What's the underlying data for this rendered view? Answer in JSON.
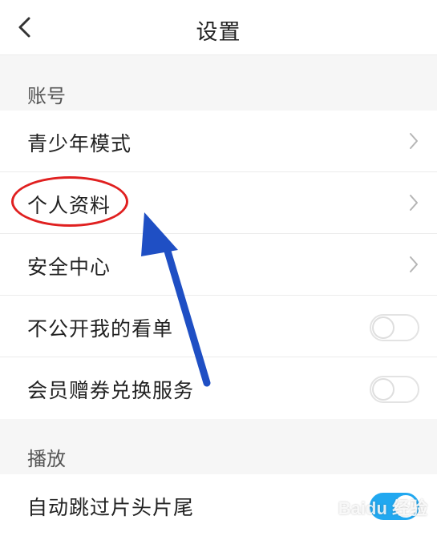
{
  "header": {
    "title": "设置",
    "back_icon": "chevron-left-icon"
  },
  "sections": [
    {
      "label": "账号",
      "items": [
        {
          "label": "青少年模式",
          "control": "chevron"
        },
        {
          "label": "个人资料",
          "control": "chevron"
        },
        {
          "label": "安全中心",
          "control": "chevron"
        },
        {
          "label": "不公开我的看单",
          "control": "toggle",
          "on": false
        },
        {
          "label": "会员赠券兑换服务",
          "control": "toggle",
          "on": false
        }
      ]
    },
    {
      "label": "播放",
      "items": [
        {
          "label": "自动跳过片头片尾",
          "control": "toggle",
          "on": true
        }
      ]
    }
  ],
  "annotations": {
    "highlight_color": "#e02020",
    "arrow_color": "#1f4fc4"
  },
  "watermark": "Baidu 经验"
}
